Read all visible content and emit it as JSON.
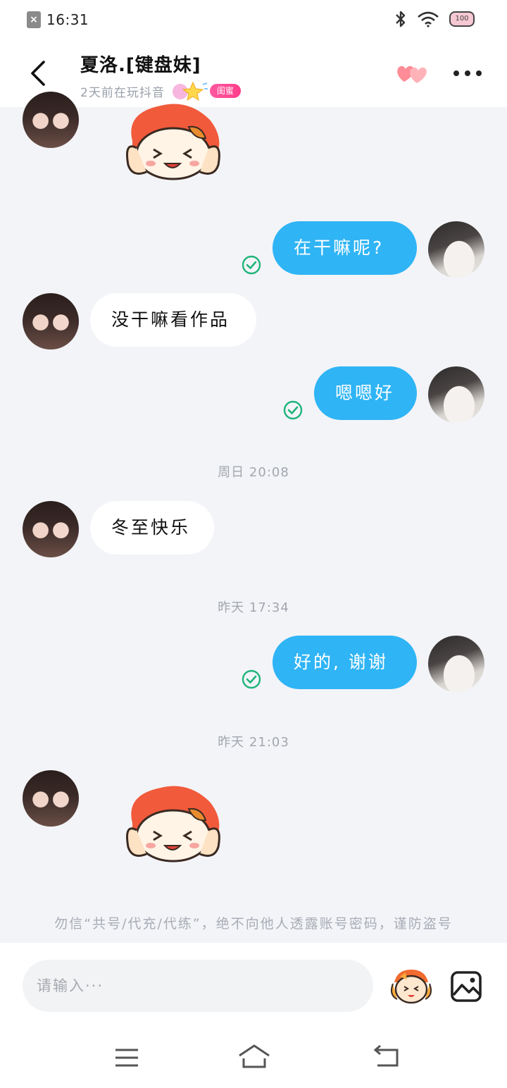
{
  "status_bar": {
    "sim_label": "×",
    "time": "16:31",
    "battery_label": "100"
  },
  "header": {
    "title": "夏洛.[键盘妹]",
    "subtitle": "2天前在玩抖音",
    "badge_label": "闺蜜"
  },
  "messages": [
    {
      "sender": "other",
      "type": "sticker"
    },
    {
      "sender": "self",
      "type": "text",
      "text": "在干嘛呢?",
      "status": "sent"
    },
    {
      "sender": "other",
      "type": "text",
      "text": "没干嘛看作品"
    },
    {
      "sender": "self",
      "type": "text",
      "text": "嗯嗯好",
      "status": "sent"
    },
    {
      "sender": "system",
      "type": "timestamp",
      "text": "周日 20:08"
    },
    {
      "sender": "other",
      "type": "text",
      "text": "冬至快乐"
    },
    {
      "sender": "system",
      "type": "timestamp",
      "text": "昨天 17:34"
    },
    {
      "sender": "self",
      "type": "text",
      "text": "好的, 谢谢",
      "status": "sent"
    },
    {
      "sender": "system",
      "type": "timestamp",
      "text": "昨天 21:03"
    },
    {
      "sender": "other",
      "type": "sticker"
    }
  ],
  "warning_text": "勿信“共号/代充/代练”，绝不向他人透露账号密码，谨防盗号",
  "input": {
    "placeholder": "请输入···"
  },
  "colors": {
    "self_bubble": "#2fb4f5",
    "other_bubble": "#ffffff",
    "check": "#1fb47a",
    "background": "#f3f4f8"
  },
  "icons": [
    "back-arrow-icon",
    "hearts-icon",
    "more-icon",
    "check-circle-icon",
    "emoji-icon",
    "image-icon",
    "menu-icon",
    "home-icon",
    "return-icon",
    "bluetooth-icon",
    "wifi-icon",
    "battery-icon"
  ]
}
